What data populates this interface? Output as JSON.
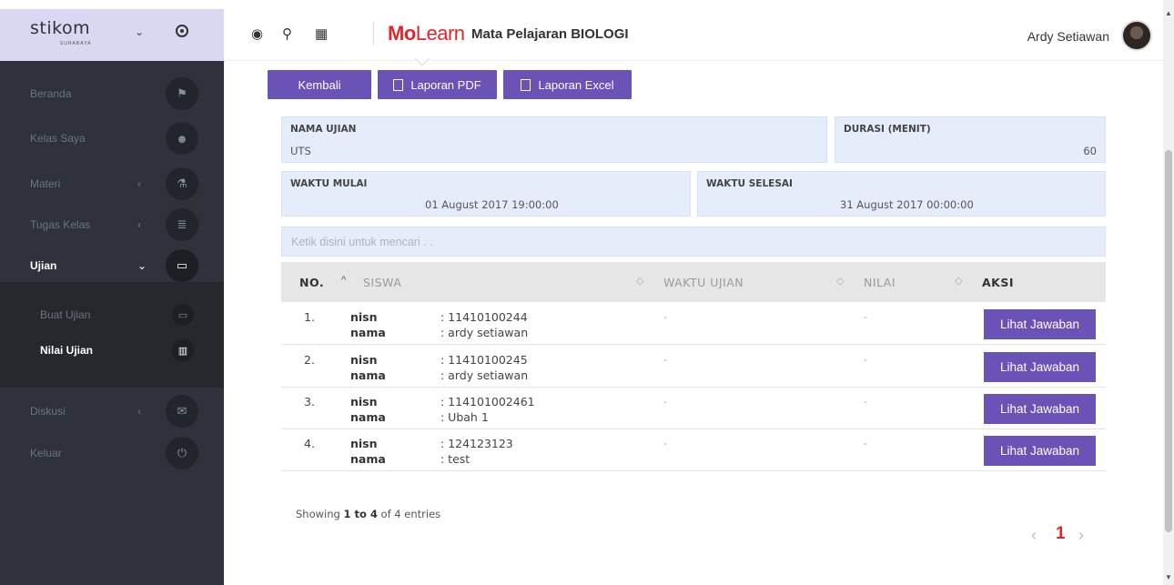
{
  "brand": {
    "logo": "stikom",
    "sub": "SURABAYA"
  },
  "sidebar": {
    "items": [
      {
        "label": "Beranda",
        "icon": "flag-icon"
      },
      {
        "label": "Kelas Saya",
        "icon": "users-icon"
      },
      {
        "label": "Materi",
        "icon": "flask-icon",
        "arrow": "‹"
      },
      {
        "label": "Tugas Kelas",
        "icon": "list-icon",
        "arrow": "‹"
      },
      {
        "label": "Ujian",
        "icon": "monitor-icon",
        "arrow": "⌄",
        "active": true
      },
      {
        "label": "Diskusi",
        "icon": "chat-icon",
        "arrow": "‹"
      },
      {
        "label": "Keluar",
        "icon": "power-icon"
      }
    ],
    "submenu": [
      {
        "label": "Buat Ujian",
        "icon": "monitor-icon"
      },
      {
        "label": "Nilai Ujian",
        "icon": "bar-chart-icon",
        "active": true
      }
    ]
  },
  "header": {
    "logo_mo": "Mo",
    "logo_learn": "Learn",
    "subject": "Mata Pelajaran BIOLOGI",
    "user": "Ardy Setiawan"
  },
  "actions": {
    "back": "Kembali",
    "pdf": "Laporan PDF",
    "excel": "Laporan Excel"
  },
  "info": {
    "nama_label": "NAMA UJIAN",
    "nama_value": "UTS",
    "durasi_label": "DURASI (MENIT)",
    "durasi_value": "60",
    "mulai_label": "WAKTU MULAI",
    "mulai_value": "01 August 2017 19:00:00",
    "selesai_label": "WAKTU SELESAI",
    "selesai_value": "31 August 2017 00:00:00"
  },
  "search": {
    "placeholder": "Ketik disini untuk mencari . ."
  },
  "table": {
    "headers": {
      "no": "NO.",
      "siswa": "SISWA",
      "waktu": "WAKTU UJIAN",
      "nilai": "NILAI",
      "aksi": "AKSI"
    },
    "rows": [
      {
        "no": "1.",
        "nisn_label": "nisn",
        "nama_label": "nama",
        "nisn": ": 11410100244",
        "nama": ": ardy setiawan",
        "waktu": "-",
        "nilai": "-",
        "action": "Lihat Jawaban"
      },
      {
        "no": "2.",
        "nisn_label": "nisn",
        "nama_label": "nama",
        "nisn": ": 11410100245",
        "nama": ": ardy setiawan",
        "waktu": "-",
        "nilai": "-",
        "action": "Lihat Jawaban"
      },
      {
        "no": "3.",
        "nisn_label": "nisn",
        "nama_label": "nama",
        "nisn": ": 114101002461",
        "nama": ": Ubah 1",
        "waktu": "-",
        "nilai": "-",
        "action": "Lihat Jawaban"
      },
      {
        "no": "4.",
        "nisn_label": "nisn",
        "nama_label": "nama",
        "nisn": ": 124123123",
        "nama": ": test",
        "waktu": "-",
        "nilai": "-",
        "action": "Lihat Jawaban"
      }
    ]
  },
  "footer": {
    "showing_prefix": "Showing ",
    "showing_range": "1 to 4",
    "showing_suffix": " of 4 entries",
    "page": "1"
  },
  "colors": {
    "accent": "#6a52b6",
    "brand_red": "#e0262b",
    "sidebar": "#2f323a",
    "info_bg": "#e5edfb"
  }
}
